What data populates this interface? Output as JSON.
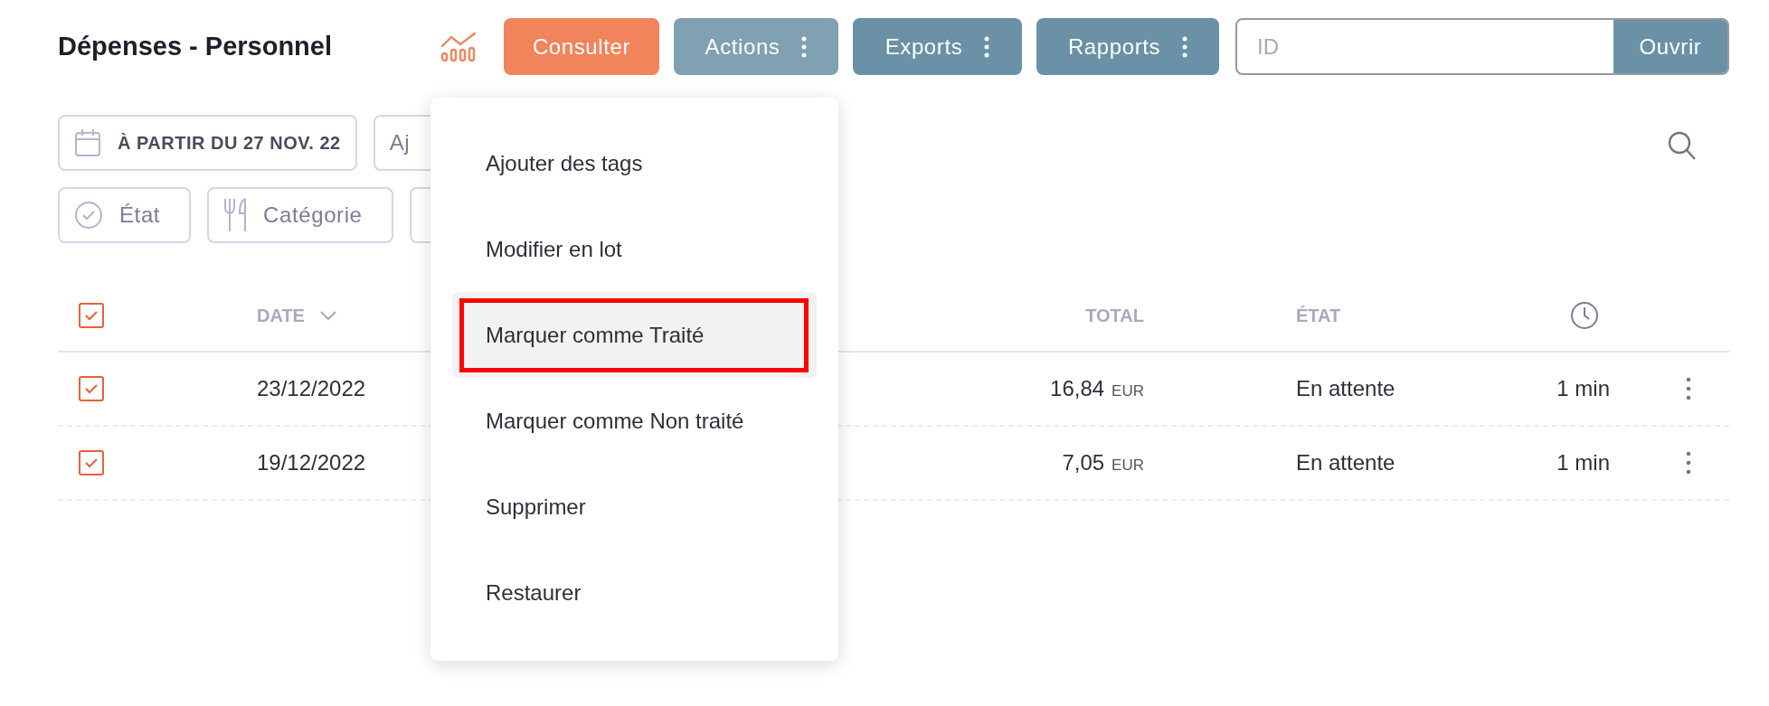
{
  "title": "Dépenses - Personnel",
  "toolbar": [
    {
      "label": "Consulter",
      "kind": "primary",
      "expanded": false
    },
    {
      "label": "Actions",
      "kind": "menu",
      "expanded": true
    },
    {
      "label": "Exports",
      "kind": "menu",
      "expanded": false
    },
    {
      "label": "Rapports",
      "kind": "menu",
      "expanded": false
    }
  ],
  "id_search": {
    "placeholder": "ID",
    "button": "Ouvrir"
  },
  "filters": [
    [
      {
        "label": "À PARTIR DU 27 NOV. 22",
        "kind": "date"
      },
      {
        "label": "Aj",
        "kind": "plain"
      }
    ],
    [
      {
        "label": "État",
        "kind": "state"
      },
      {
        "label": "Catégorie",
        "kind": "category"
      },
      {
        "kind": "plain"
      }
    ]
  ],
  "table": {
    "select_all": {
      "checked": true
    },
    "columns": [
      {
        "label": "DATE",
        "kind": "date",
        "sorted": true
      },
      {
        "label": "TOTAL",
        "kind": "total",
        "sorted": false
      },
      {
        "label": "ÉTAT",
        "kind": "state",
        "sorted": false
      },
      {
        "kind": "time",
        "sorted": false
      }
    ],
    "rows": [
      {
        "checked": true,
        "date": "23/12/2022",
        "amount": "16,84",
        "currency": "EUR",
        "state": "En attente",
        "age": "1 min"
      },
      {
        "checked": true,
        "date": "19/12/2022",
        "amount": "7,05",
        "currency": "EUR",
        "state": "En attente",
        "age": "1 min"
      }
    ]
  },
  "menu": {
    "items": [
      {
        "label": "Ajouter des tags",
        "selected": false,
        "outlined": false
      },
      {
        "label": "Modifier en lot",
        "selected": false,
        "outlined": false
      },
      {
        "label": "Marquer comme Traité",
        "selected": true,
        "outlined": true
      },
      {
        "label": "Marquer comme Non traité",
        "selected": false,
        "outlined": false
      },
      {
        "label": "Supprimer",
        "selected": false,
        "outlined": false
      },
      {
        "label": "Restaurer",
        "selected": false,
        "outlined": false
      }
    ]
  }
}
